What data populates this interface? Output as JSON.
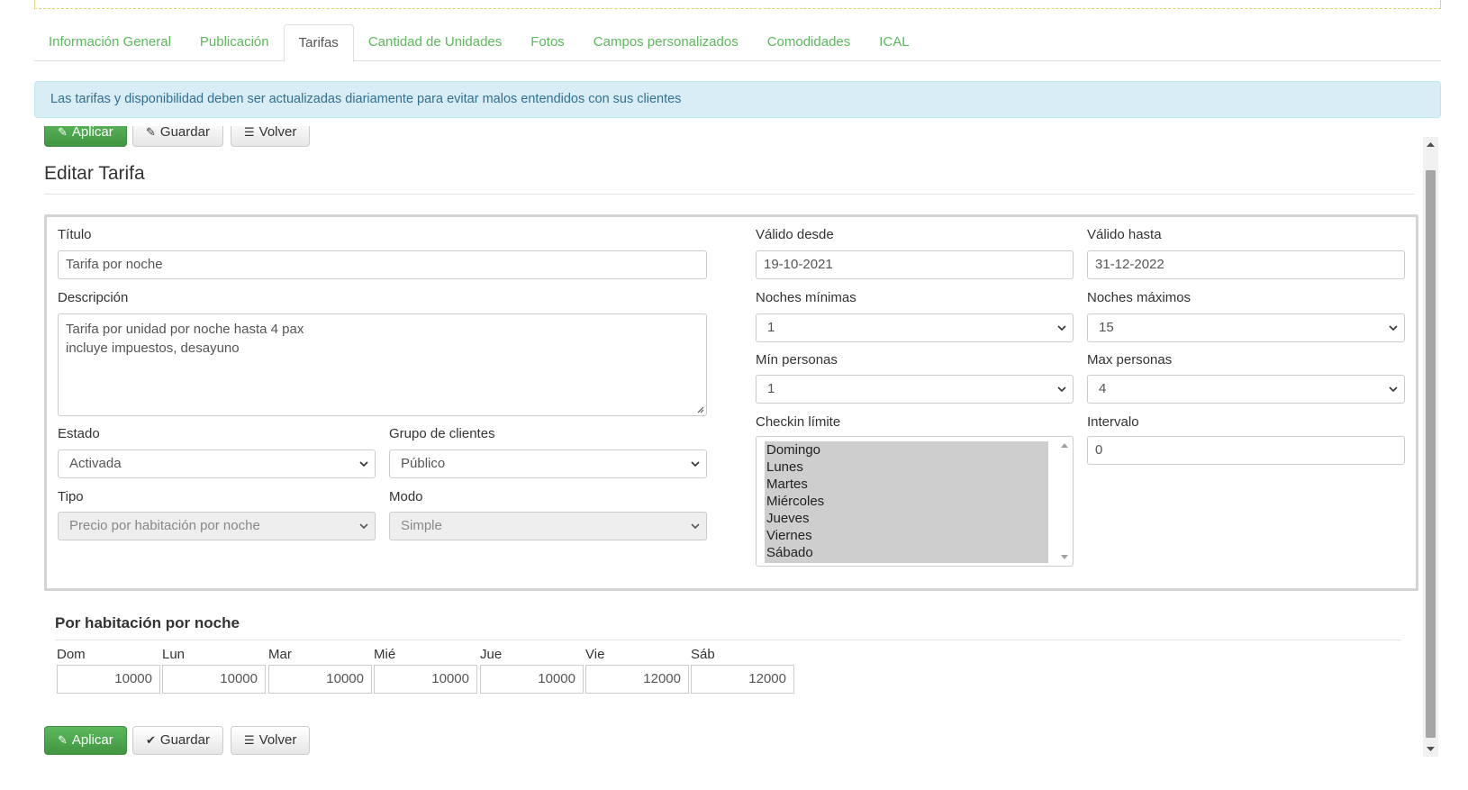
{
  "tabs": [
    {
      "label": "Información General",
      "active": false
    },
    {
      "label": "Publicación",
      "active": false
    },
    {
      "label": "Tarifas",
      "active": true
    },
    {
      "label": "Cantidad de Unidades",
      "active": false
    },
    {
      "label": "Fotos",
      "active": false
    },
    {
      "label": "Campos personalizados",
      "active": false
    },
    {
      "label": "Comodidades",
      "active": false
    },
    {
      "label": "ICAL",
      "active": false
    }
  ],
  "alert": {
    "text": "Las tarifas y disponibilidad deben ser actualizadas diariamente para evitar malos entendidos con sus clientes"
  },
  "toolbar": {
    "apply_label": "Aplicar",
    "save_label": "Guardar",
    "back_label": "Volver"
  },
  "page_title": "Editar Tarifa",
  "form": {
    "titulo": {
      "label": "Título",
      "value": "Tarifa por noche"
    },
    "descripcion": {
      "label": "Descripción",
      "line1": "Tarifa por unidad por noche hasta 4 pax",
      "line2": "incluye impuestos, desayuno"
    },
    "estado": {
      "label": "Estado",
      "value": "Activada"
    },
    "grupo": {
      "label": "Grupo de clientes",
      "value": "Público"
    },
    "tipo": {
      "label": "Tipo",
      "value": "Precio por habitación por noche"
    },
    "modo": {
      "label": "Modo",
      "value": "Simple"
    },
    "valido_desde": {
      "label": "Válido desde",
      "value": "19-10-2021"
    },
    "valido_hasta": {
      "label": "Válido hasta",
      "value": "31-12-2022"
    },
    "noches_min": {
      "label": "Noches mínimas",
      "value": "1"
    },
    "noches_max": {
      "label": "Noches máximos",
      "value": "15"
    },
    "min_personas": {
      "label": "Mín personas",
      "value": "1"
    },
    "max_personas": {
      "label": "Max personas",
      "value": "4"
    },
    "checkin": {
      "label": "Checkin límite",
      "options": [
        "Domingo",
        "Lunes",
        "Martes",
        "Miércoles",
        "Jueves",
        "Viernes",
        "Sábado"
      ]
    },
    "intervalo": {
      "label": "Intervalo",
      "value": "0"
    }
  },
  "pricing": {
    "title": "Por habitación por noche",
    "days": [
      {
        "label": "Dom",
        "value": "10000"
      },
      {
        "label": "Lun",
        "value": "10000"
      },
      {
        "label": "Mar",
        "value": "10000"
      },
      {
        "label": "Mié",
        "value": "10000"
      },
      {
        "label": "Jue",
        "value": "10000"
      },
      {
        "label": "Vie",
        "value": "12000"
      },
      {
        "label": "Sáb",
        "value": "12000"
      }
    ]
  },
  "colors": {
    "accent_green": "#5cb85c",
    "alert_bg": "#d9edf7",
    "alert_text": "#31708f"
  },
  "icons": {
    "apply": "edit-icon",
    "save_top": "edit-icon",
    "save_bottom": "check-icon",
    "back": "list-icon"
  }
}
